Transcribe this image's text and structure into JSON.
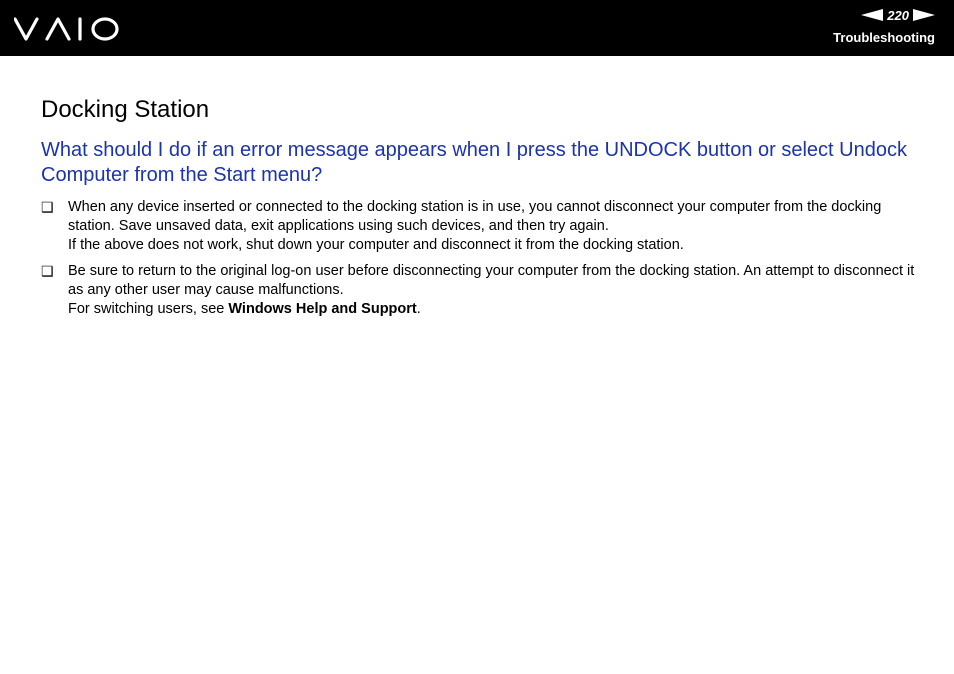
{
  "header": {
    "logo_text": "VAIO",
    "page_number": "220",
    "section": "Troubleshooting",
    "icons": {
      "prev": "arrow-left-icon",
      "next": "arrow-right-icon"
    }
  },
  "content": {
    "title": "Docking Station",
    "question": "What should I do if an error message appears when I press the UNDOCK button or select Undock Computer from the Start menu?",
    "items": [
      {
        "bullet": "❑",
        "lines": [
          "When any device inserted or connected to the docking station is in use, you cannot disconnect your computer from the docking station. Save unsaved data, exit applications using such devices, and then try again.",
          "If the above does not work, shut down your computer and disconnect it from the docking station."
        ]
      },
      {
        "bullet": "❑",
        "lines": [
          "Be sure to return to the original log-on user before disconnecting your computer from the docking station. An attempt to disconnect it as any other user may cause malfunctions."
        ],
        "link_prefix": "For switching users, see ",
        "link_bold": "Windows Help and Support",
        "link_suffix": "."
      }
    ]
  },
  "colors": {
    "header_bg": "#000000",
    "question_blue": "#1c34a8"
  }
}
